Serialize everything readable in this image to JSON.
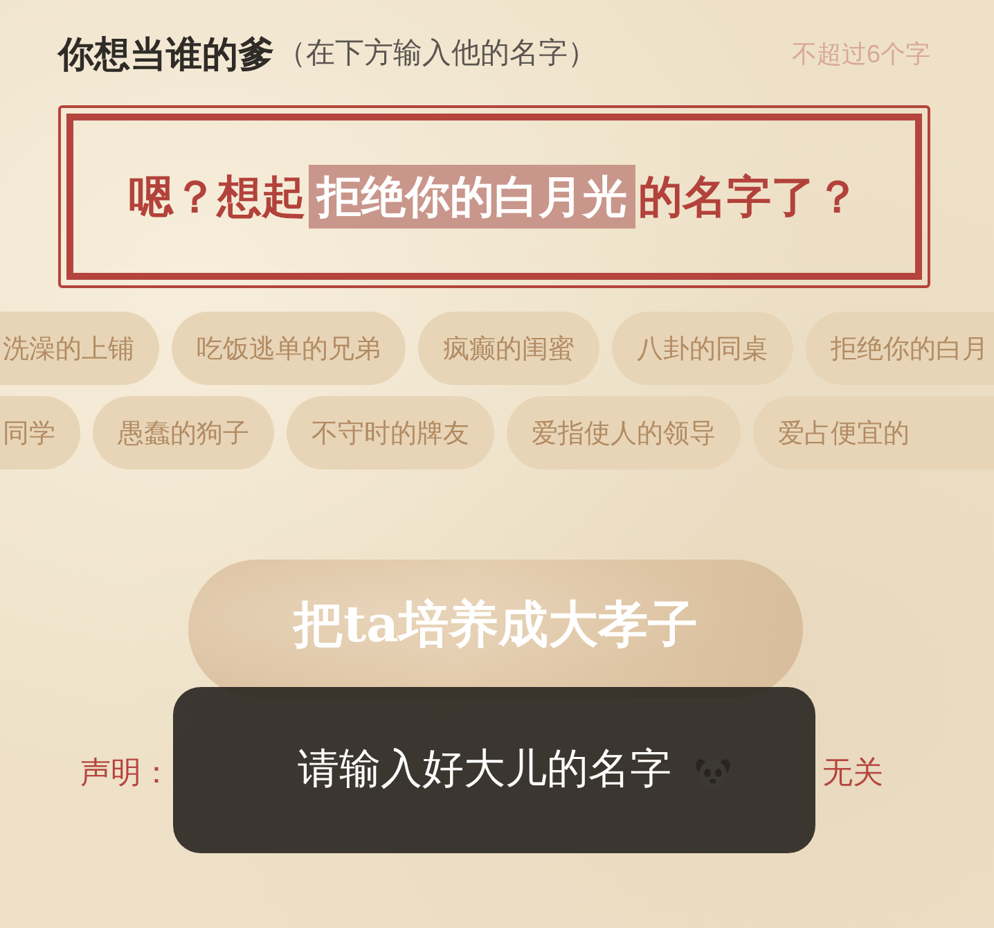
{
  "header": {
    "title": "你想当谁的爹",
    "hint": "（在下方输入他的名字）",
    "limit_note": "不超过6个字"
  },
  "name_input": {
    "prompt_before": "嗯？想起",
    "highlight": "拒绝你的白月光",
    "prompt_after": "的名字了？"
  },
  "suggestion_rows": [
    [
      "洗澡的上铺",
      "吃饭逃单的兄弟",
      "疯癫的闺蜜",
      "八卦的同桌",
      "拒绝你的白月"
    ],
    [
      "同学",
      "愚蠢的狗子",
      "不守时的牌友",
      "爱指使人的领导",
      "爱占便宜的"
    ]
  ],
  "submit_button": {
    "label": "把ta培养成大孝子"
  },
  "disclaimer": {
    "visible_start": "声明：",
    "visible_end": "无关"
  },
  "toast": {
    "message": "请输入好大儿的名字"
  }
}
